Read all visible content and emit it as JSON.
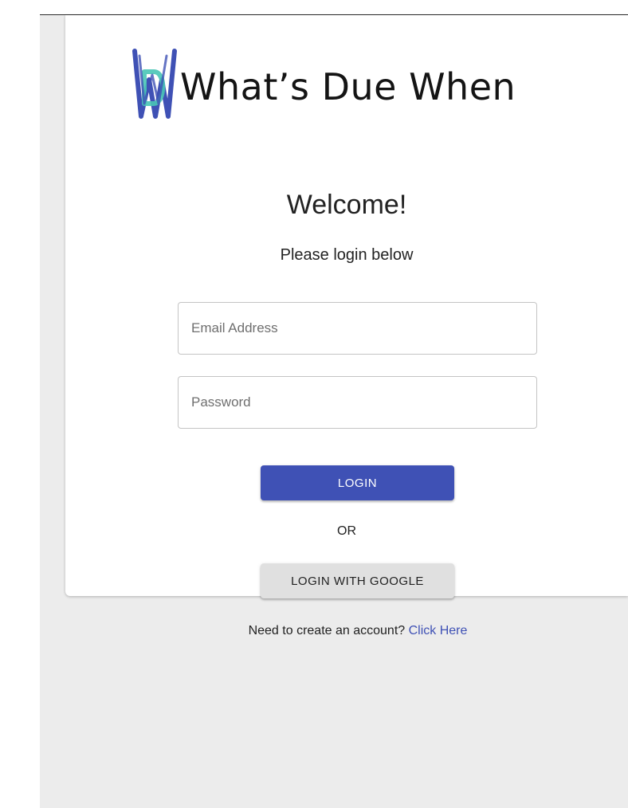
{
  "brand": {
    "logo_icon": "wdw-logo-icon",
    "name": "What’s Due When",
    "colors": {
      "logo_blue": "#3f51b5",
      "logo_teal": "#49c5b6"
    }
  },
  "login": {
    "heading": "Welcome!",
    "subheading": "Please login below",
    "email_placeholder": "Email Address",
    "password_placeholder": "Password",
    "login_label": "LOGIN",
    "separator": "OR",
    "google_label": "LOGIN WITH GOOGLE",
    "signup_prompt": "Need to create an account?",
    "signup_link": "Click Here"
  },
  "colors": {
    "primary": "#3f51b5",
    "secondary_button": "#e0e0e0",
    "page_background": "#ececec"
  }
}
